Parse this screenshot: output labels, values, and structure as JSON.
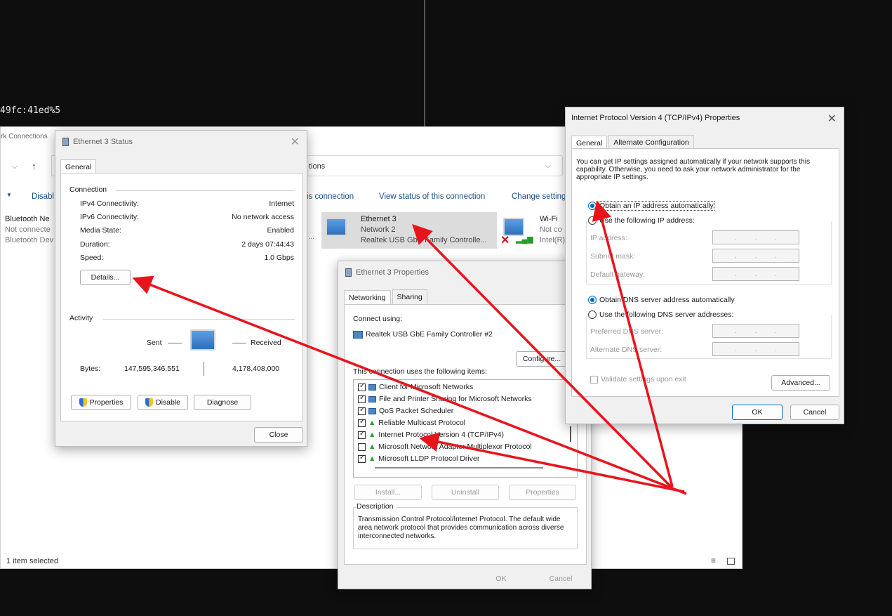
{
  "terminal": {
    "text": "49fc:41ed%5"
  },
  "netwin": {
    "title": "rk Connections",
    "address": "tions",
    "nav_up": "↑",
    "nav_down": "⌵",
    "cmd_disable": "Disabl",
    "cmd_diagnose": "is connection",
    "cmd_view_status": "View status of this connection",
    "cmd_change": "Change setting",
    "side": [
      {
        "name": "Bluetooth Ne",
        "status": "Not connecte",
        "device": "Bluetooth Dev"
      }
    ],
    "adapters": [
      {
        "name": "Ethernet 3",
        "network": "Network 2",
        "device": "Realtek USB GbE Family Controlle..."
      },
      {
        "name": "Wi-Fi",
        "network": "Not co",
        "device": "Intel(R)"
      }
    ],
    "ellipsis": "...",
    "status_bar": "1 item selected"
  },
  "status_dlg": {
    "title": "Ethernet 3 Status",
    "tab": "General",
    "connection_label": "Connection",
    "rows": [
      {
        "label": "IPv4 Connectivity:",
        "value": "Internet"
      },
      {
        "label": "IPv6 Connectivity:",
        "value": "No network access"
      },
      {
        "label": "Media State:",
        "value": "Enabled"
      },
      {
        "label": "Duration:",
        "value": "2 days 07:44:43"
      },
      {
        "label": "Speed:",
        "value": "1.0 Gbps"
      }
    ],
    "details_btn": "Details...",
    "activity_label": "Activity",
    "sent": "Sent",
    "received": "Received",
    "bytes_label": "Bytes:",
    "bytes_sent": "147,595,346,551",
    "bytes_received": "4,178,408,000",
    "properties_btn": "Properties",
    "disable_btn": "Disable",
    "diagnose_btn": "Diagnose",
    "close_btn": "Close"
  },
  "props_dlg": {
    "title": "Ethernet 3 Properties",
    "tabs": [
      "Networking",
      "Sharing"
    ],
    "connect_using": "Connect using:",
    "adapter": "Realtek USB GbE Family Controller #2",
    "configure_btn": "Configure...",
    "items_label": "This connection uses the following items:",
    "items": [
      {
        "label": "Client for Microsoft Networks",
        "checked": true
      },
      {
        "label": "File and Printer Sharing for Microsoft Networks",
        "checked": true
      },
      {
        "label": "QoS Packet Scheduler",
        "checked": true
      },
      {
        "label": "Reliable Multicast Protocol",
        "checked": true
      },
      {
        "label": "Internet Protocol Version 4 (TCP/IPv4)",
        "checked": true
      },
      {
        "label": "Microsoft Network Adapter Multiplexor Protocol",
        "checked": false
      },
      {
        "label": "Microsoft LLDP Protocol Driver",
        "checked": true
      }
    ],
    "install_btn": "Install...",
    "uninstall_btn": "Uninstall",
    "properties_btn": "Properties",
    "description_label": "Description",
    "description": "Transmission Control Protocol/Internet Protocol. The default wide area network protocol that provides communication across diverse interconnected networks.",
    "ok_btn": "OK",
    "cancel_btn": "Cancel"
  },
  "ipv4_dlg": {
    "title": "Internet Protocol Version 4 (TCP/IPv4) Properties",
    "close": "✕",
    "tabs": [
      "General",
      "Alternate Configuration"
    ],
    "intro": "You can get IP settings assigned automatically if your network supports this capability. Otherwise, you need to ask your network administrator for the appropriate IP settings.",
    "obtain_ip": "Obtain an IP address automatically",
    "use_ip": "Use the following IP address:",
    "ip_address": "IP address:",
    "subnet": "Subnet mask:",
    "gateway": "Default gateway:",
    "obtain_dns": "Obtain DNS server address automatically",
    "use_dns": "Use the following DNS server addresses:",
    "pref_dns": "Preferred DNS server:",
    "alt_dns": "Alternate DNS server:",
    "validate": "Validate settings upon exit",
    "advanced_btn": "Advanced...",
    "ok_btn": "OK",
    "cancel_btn": "Cancel",
    "ip_dots": "."
  },
  "annotation": {
    "arrow_color": "#e8141c"
  }
}
